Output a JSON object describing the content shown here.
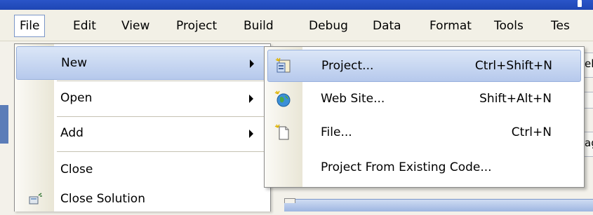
{
  "menubar": {
    "items": [
      "File",
      "Edit",
      "View",
      "Project",
      "Build",
      "Debug",
      "Data",
      "Format",
      "Tools",
      "Tes"
    ]
  },
  "file_menu": {
    "items": [
      {
        "label": "New",
        "has_submenu": true
      },
      {
        "label": "Open",
        "has_submenu": true
      },
      {
        "label": "Add",
        "has_submenu": true
      },
      {
        "label": "Close",
        "has_submenu": false
      },
      {
        "label": "Close Solution",
        "has_submenu": false
      }
    ]
  },
  "new_submenu": {
    "items": [
      {
        "label": "Project...",
        "shortcut": "Ctrl+Shift+N",
        "icon": "new-project-icon"
      },
      {
        "label": "Web Site...",
        "shortcut": "Shift+Alt+N",
        "icon": "web-site-icon"
      },
      {
        "label": "File...",
        "shortcut": "Ctrl+N",
        "icon": "new-file-icon"
      },
      {
        "label": "Project From Existing Code...",
        "shortcut": "",
        "icon": ""
      }
    ]
  },
  "background_fragments": [
    "el",
    "ag"
  ],
  "colors": {
    "highlight_top": "#dbe6f7",
    "highlight_bottom": "#b6c9ec",
    "title_bar": "#2a55c8",
    "menubar_bg": "#f2f0e6"
  }
}
